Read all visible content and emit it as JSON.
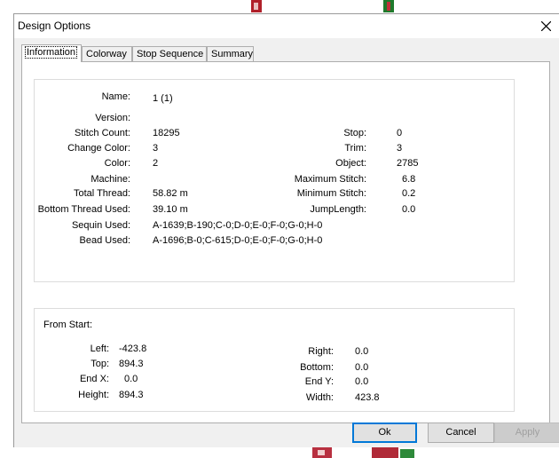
{
  "window": {
    "title": "Design Options"
  },
  "tabs": [
    "Information",
    "Colorway",
    "Stop Sequence",
    "Summary"
  ],
  "info": {
    "name_label": "Name:",
    "name_value": "1 (1)",
    "version_label": "Version:",
    "version_value": "",
    "stitch_count_label": "Stitch Count:",
    "stitch_count_value": "18295",
    "change_color_label": "Change Color:",
    "change_color_value": "3",
    "color_label": "Color:",
    "color_value": "2",
    "machine_label": "Machine:",
    "machine_value": "",
    "total_thread_label": "Total Thread:",
    "total_thread_value": "58.82 m",
    "bottom_thread_label": "Bottom Thread Used:",
    "bottom_thread_value": "39.10 m",
    "sequin_label": "Sequin Used:",
    "sequin_value": "A-1639;B-190;C-0;D-0;E-0;F-0;G-0;H-0",
    "bead_label": "Bead Used:",
    "bead_value": "A-1696;B-0;C-615;D-0;E-0;F-0;G-0;H-0",
    "stop_label": "Stop:",
    "stop_value": "0",
    "trim_label": "Trim:",
    "trim_value": "3",
    "object_label": "Object:",
    "object_value": "2785",
    "max_stitch_label": "Maximum Stitch:",
    "max_stitch_value": "6.8",
    "min_stitch_label": "Minimum Stitch:",
    "min_stitch_value": "0.2",
    "jump_length_label": "JumpLength:",
    "jump_length_value": "0.0"
  },
  "from_start": {
    "heading": "From Start:",
    "left_label": "Left:",
    "left_value": "-423.8",
    "top_label": "Top:",
    "top_value": "894.3",
    "endx_label": "End X:",
    "endx_value": "0.0",
    "height_label": "Height:",
    "height_value": "894.3",
    "right_label": "Right:",
    "right_value": "0.0",
    "bottom_label": "Bottom:",
    "bottom_value": "0.0",
    "endy_label": "End Y:",
    "endy_value": "0.0",
    "width_label": "Width:",
    "width_value": "423.8"
  },
  "buttons": {
    "ok": "Ok",
    "cancel": "Cancel",
    "apply": "Apply"
  }
}
